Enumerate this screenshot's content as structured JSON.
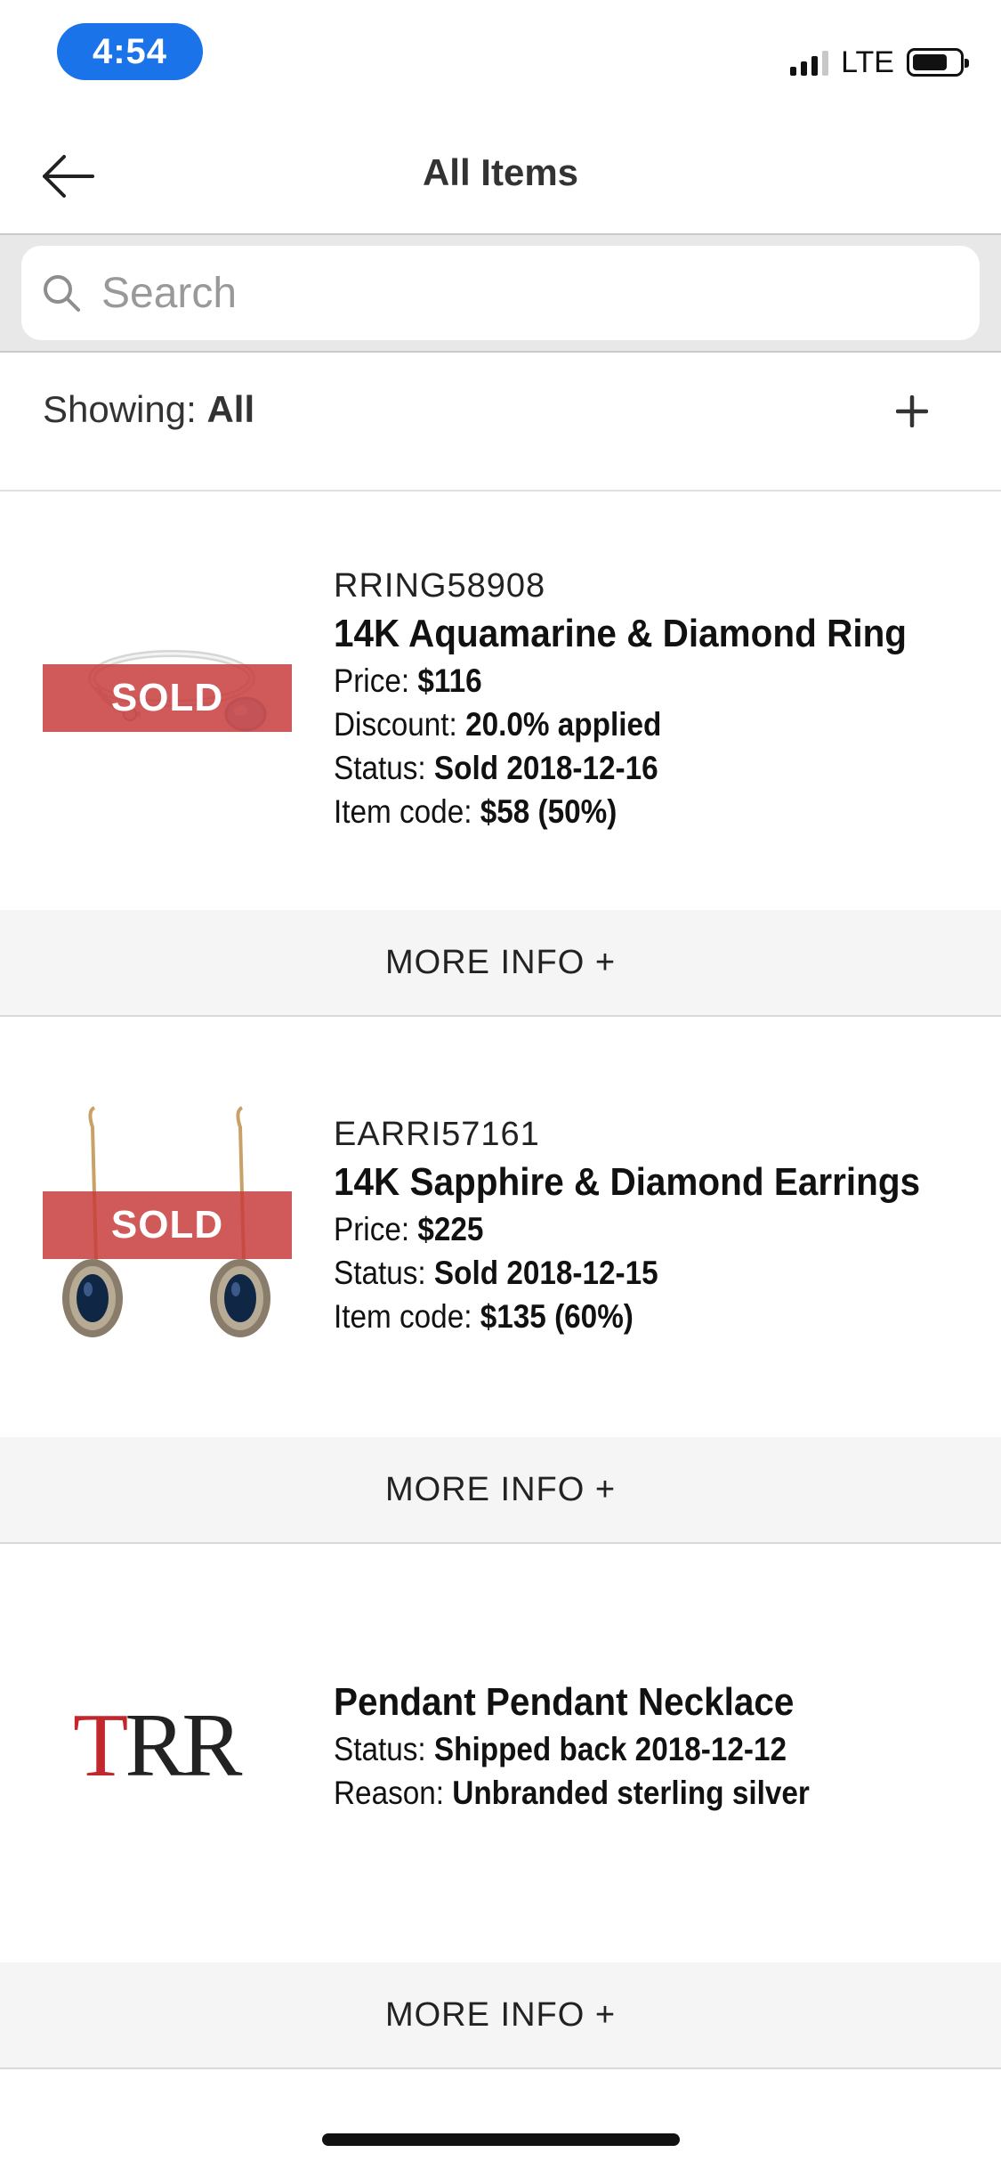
{
  "status_bar": {
    "time": "4:54",
    "network": "LTE"
  },
  "nav": {
    "title": "All Items"
  },
  "search": {
    "placeholder": "Search",
    "value": ""
  },
  "filter": {
    "label": "Showing:",
    "value": "All"
  },
  "items": [
    {
      "sku": "RRING58908",
      "name": "14K Aquamarine & Diamond Ring",
      "badge": "SOLD",
      "details": [
        {
          "label": "Price:",
          "value": "$116"
        },
        {
          "label": "Discount:",
          "value": "20.0% applied"
        },
        {
          "label": "Status:",
          "value": "Sold 2018-12-16"
        },
        {
          "label": "Item code:",
          "value": "$58 (50%)"
        }
      ],
      "more_info": "MORE INFO +"
    },
    {
      "sku": "EARRI57161",
      "name": "14K Sapphire & Diamond Earrings",
      "badge": "SOLD",
      "details": [
        {
          "label": "Price:",
          "value": "$225"
        },
        {
          "label": "Status:",
          "value": "Sold 2018-12-15"
        },
        {
          "label": "Item code:",
          "value": "$135 (60%)"
        }
      ],
      "more_info": "MORE INFO +"
    },
    {
      "sku": "",
      "name": "Pendant Pendant Necklace",
      "logo_text": "TRR",
      "details": [
        {
          "label": "Status:",
          "value": "Shipped back 2018-12-12"
        },
        {
          "label": "Reason:",
          "value": "Unbranded sterling silver"
        }
      ],
      "more_info": "MORE INFO +"
    }
  ],
  "colors": {
    "accent": "#1a73e8",
    "sold_badge": "#c83c3c",
    "logo_red": "#c1272d"
  },
  "icons": [
    "signal-icon",
    "battery-icon",
    "back-arrow-icon",
    "search-icon",
    "plus-icon"
  ]
}
